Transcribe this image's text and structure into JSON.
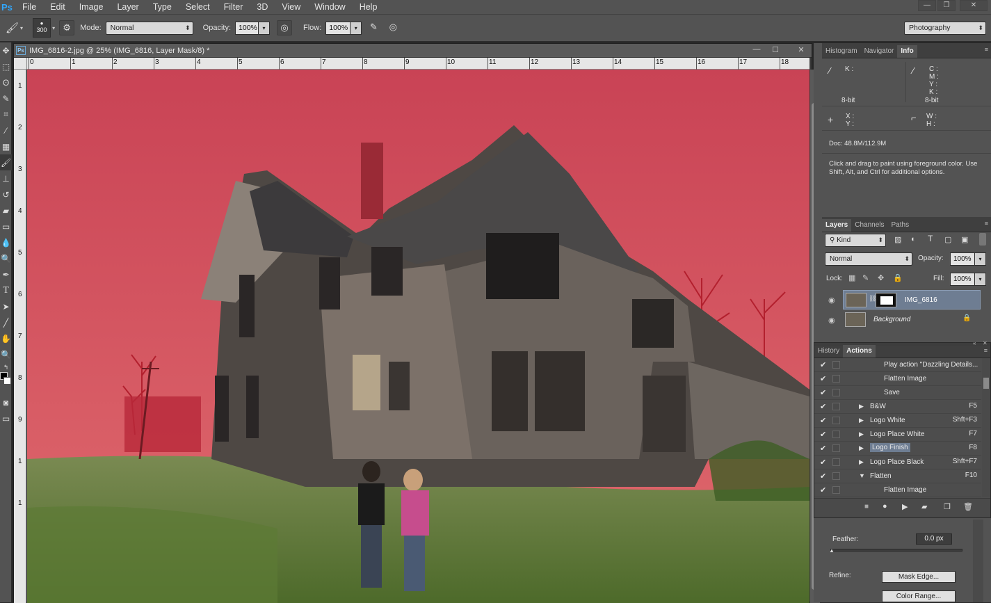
{
  "app": {
    "logo": "Ps"
  },
  "menu": [
    "File",
    "Edit",
    "Image",
    "Layer",
    "Type",
    "Select",
    "Filter",
    "3D",
    "View",
    "Window",
    "Help"
  ],
  "options": {
    "brush_size": "300",
    "mode_label": "Mode:",
    "mode_value": "Normal",
    "opacity_label": "Opacity:",
    "opacity_value": "100%",
    "flow_label": "Flow:",
    "flow_value": "100%",
    "workspace": "Photography"
  },
  "document": {
    "tab_title": "IMG_6816-2.jpg @ 25% (IMG_6816, Layer Mask/8) *",
    "ruler_h": [
      "0",
      "1",
      "2",
      "3",
      "4",
      "5",
      "6",
      "7",
      "8",
      "9",
      "10",
      "11",
      "12",
      "13",
      "14",
      "15",
      "16",
      "17",
      "18"
    ],
    "ruler_v": [
      "1",
      "2",
      "3",
      "4",
      "5",
      "6",
      "7",
      "8",
      "9",
      "1",
      "1"
    ],
    "overlay_color": "#cf4a5a"
  },
  "info_panel": {
    "tabs": [
      "Histogram",
      "Navigator",
      "Info"
    ],
    "k_label": "K :",
    "bit_left": "8-bit",
    "cmyk_labels": "C :\nM :\nY :\nK :",
    "bit_right": "8-bit",
    "xy_labels": "X :\nY :",
    "wh_labels": "W :\nH :",
    "doc_size": "Doc: 48.8M/112.9M",
    "hint": "Click and drag to paint using foreground color. Use Shift, Alt, and Ctrl for additional options."
  },
  "layers_panel": {
    "tabs": [
      "Layers",
      "Channels",
      "Paths"
    ],
    "kind": "Kind",
    "blend": "Normal",
    "opacity_label": "Opacity:",
    "opacity": "100%",
    "lock_label": "Lock:",
    "fill_label": "Fill:",
    "fill": "100%",
    "layers": [
      {
        "name": "IMG_6816"
      },
      {
        "name": "Background"
      }
    ]
  },
  "actions_panel": {
    "tabs": [
      "History",
      "Actions"
    ],
    "items": [
      {
        "name": "Play action \"Dazzling Details...",
        "key": "",
        "indent": 2,
        "expand": ""
      },
      {
        "name": "Flatten Image",
        "key": "",
        "indent": 2,
        "expand": ""
      },
      {
        "name": "Save",
        "key": "",
        "indent": 2,
        "expand": ""
      },
      {
        "name": "B&W",
        "key": "F5",
        "indent": 1,
        "expand": "▶"
      },
      {
        "name": "Logo White",
        "key": "Shft+F3",
        "indent": 1,
        "expand": "▶"
      },
      {
        "name": "Logo Place White",
        "key": "F7",
        "indent": 1,
        "expand": "▶"
      },
      {
        "name": "Logo Finish",
        "key": "F8",
        "indent": 1,
        "expand": "▶"
      },
      {
        "name": "Logo Place Black",
        "key": "Shft+F7",
        "indent": 1,
        "expand": "▶"
      },
      {
        "name": "Flatten",
        "key": "F10",
        "indent": 1,
        "expand": "▼"
      },
      {
        "name": "Flatten Image",
        "key": "",
        "indent": 2,
        "expand": ""
      }
    ]
  },
  "select_props": {
    "feather_label": "Feather:",
    "feather_value": "0.0 px",
    "refine_label": "Refine:",
    "mask_edge": "Mask Edge...",
    "color_range": "Color Range..."
  }
}
